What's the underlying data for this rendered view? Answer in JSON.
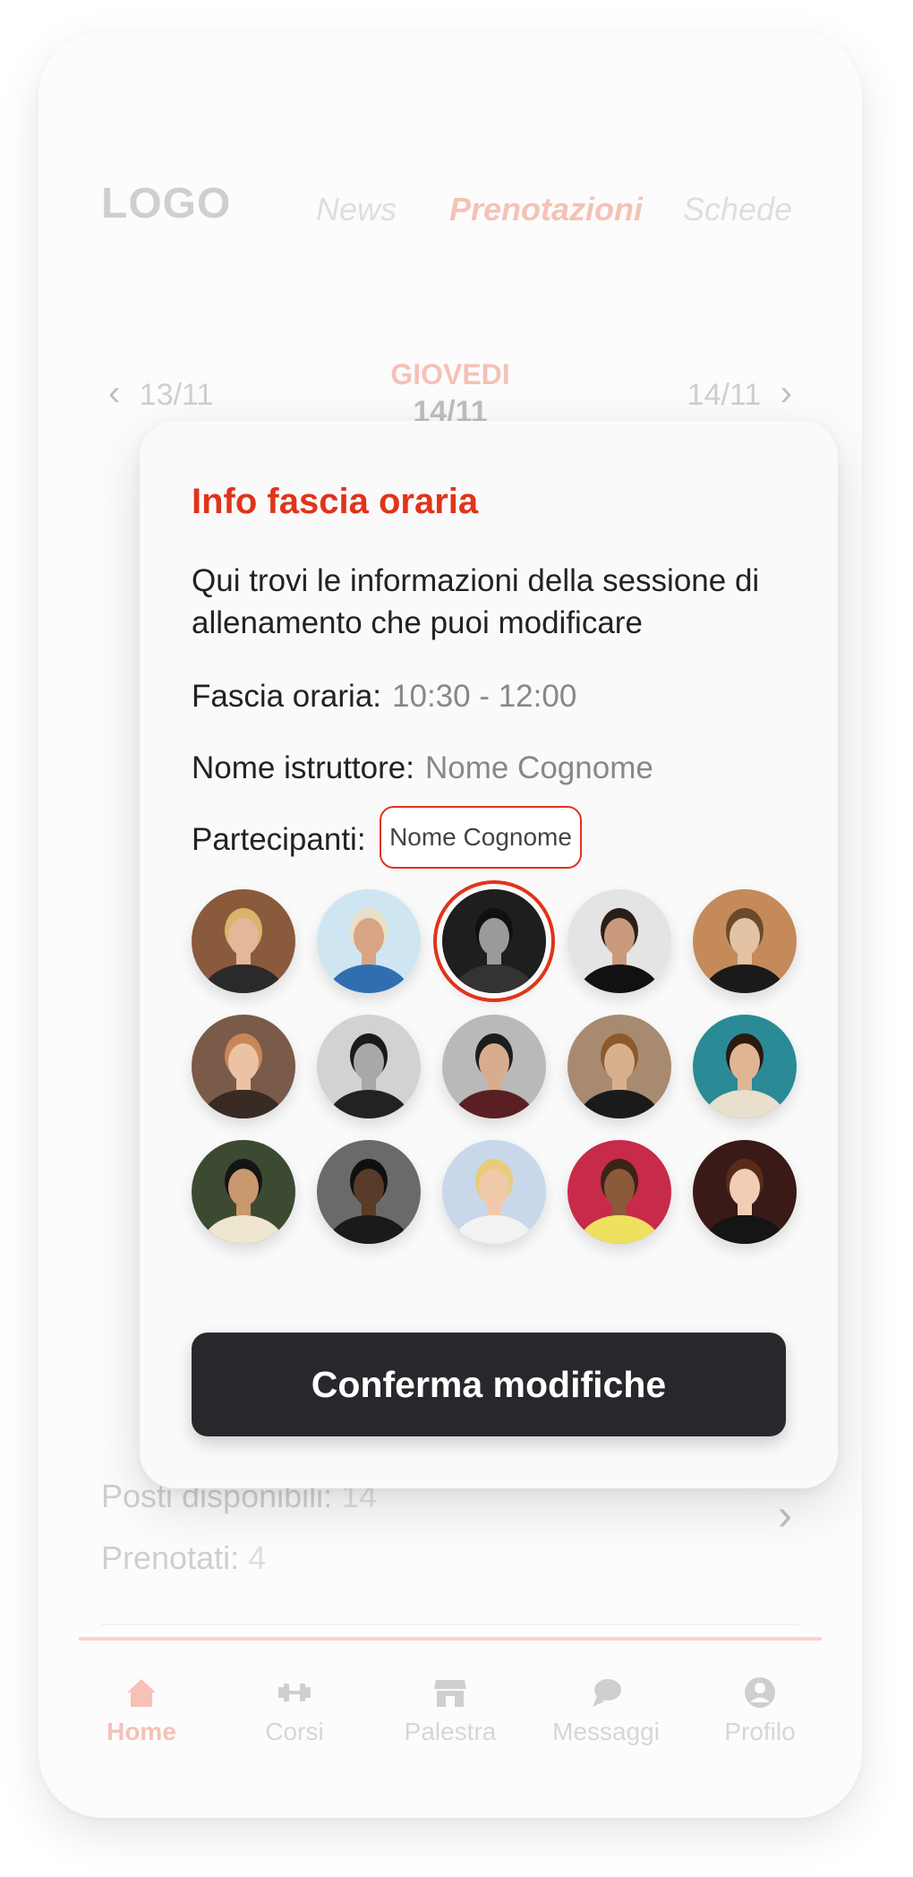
{
  "header": {
    "logo": "LOGO",
    "tabs": [
      {
        "label": "News",
        "active": false
      },
      {
        "label": "Prenotazioni",
        "active": true
      },
      {
        "label": "Schede",
        "active": false
      }
    ]
  },
  "date_nav": {
    "prev": "13/11",
    "day_name": "GIOVEDI",
    "day_date": "14/11",
    "next": "14/11"
  },
  "session_info": {
    "posti_label": "Posti disponibili:",
    "posti_value": "14",
    "prenotati_label": "Prenotati:",
    "prenotati_value": "4"
  },
  "bottom_nav": [
    {
      "label": "Home",
      "icon": "home-icon",
      "active": true
    },
    {
      "label": "Corsi",
      "icon": "dumbbell-icon",
      "active": false
    },
    {
      "label": "Palestra",
      "icon": "store-icon",
      "active": false
    },
    {
      "label": "Messaggi",
      "icon": "chat-icon",
      "active": false
    },
    {
      "label": "Profilo",
      "icon": "profile-icon",
      "active": false
    }
  ],
  "modal": {
    "title": "Info fascia oraria",
    "description": "Qui trovi le informazioni della sessione di allenamento che puoi modificare",
    "fascia_label": "Fascia oraria:",
    "fascia_value": "10:30 - 12:00",
    "istruttore_label": "Nome istruttore:",
    "istruttore_value": "Nome Cognome",
    "partecipanti_label": "Partecipanti:",
    "tooltip": "Nome Cognome",
    "confirm_label": "Conferma modifiche"
  },
  "participants": [
    {
      "bg": "#8a5a3c",
      "skin": "#e2b79a",
      "hair": "#d9b46a",
      "shirt": "#2a2a2a",
      "selected": false
    },
    {
      "bg": "#cfe6f2",
      "skin": "#d9a584",
      "hair": "#e8e0c8",
      "shirt": "#2f6fb0",
      "selected": false
    },
    {
      "bg": "#1e1e1e",
      "skin": "#9a9a9a",
      "hair": "#101010",
      "shirt": "#333333",
      "selected": true
    },
    {
      "bg": "#e4e4e4",
      "skin": "#c99a7c",
      "hair": "#2a1f18",
      "shirt": "#111111",
      "selected": false
    },
    {
      "bg": "#c58a5a",
      "skin": "#e4c2a4",
      "hair": "#6a4a2a",
      "shirt": "#1a1a1a",
      "selected": false
    },
    {
      "bg": "#7a5a48",
      "skin": "#ecc2a4",
      "hair": "#c9865a",
      "shirt": "#3a2a24",
      "selected": false
    },
    {
      "bg": "#d2d2d2",
      "skin": "#a8a8a8",
      "hair": "#1a1a1a",
      "shirt": "#222222",
      "selected": false
    },
    {
      "bg": "#b9b9b9",
      "skin": "#d7ad8e",
      "hair": "#1d1d1d",
      "shirt": "#5a1f22",
      "selected": false
    },
    {
      "bg": "#a88a70",
      "skin": "#d9b08e",
      "hair": "#8a5a2e",
      "shirt": "#1a1a1a",
      "selected": false
    },
    {
      "bg": "#2a8a96",
      "skin": "#e0b594",
      "hair": "#2a1a10",
      "shirt": "#e8dfcc",
      "selected": false
    },
    {
      "bg": "#3d4a32",
      "skin": "#c9986e",
      "hair": "#151515",
      "shirt": "#efe6cf",
      "selected": false
    },
    {
      "bg": "#6a6a6a",
      "skin": "#5a3a28",
      "hair": "#101010",
      "shirt": "#1a1a1a",
      "selected": false
    },
    {
      "bg": "#c8d8ea",
      "skin": "#f0caa8",
      "hair": "#e8cc7a",
      "shirt": "#f2f2f2",
      "selected": false
    },
    {
      "bg": "#c82a4a",
      "skin": "#8a5a3a",
      "hair": "#3a2416",
      "shirt": "#f0e060",
      "selected": false
    },
    {
      "bg": "#3a1a16",
      "skin": "#f0cdb4",
      "hair": "#5a2a1a",
      "shirt": "#151515",
      "selected": false
    }
  ]
}
